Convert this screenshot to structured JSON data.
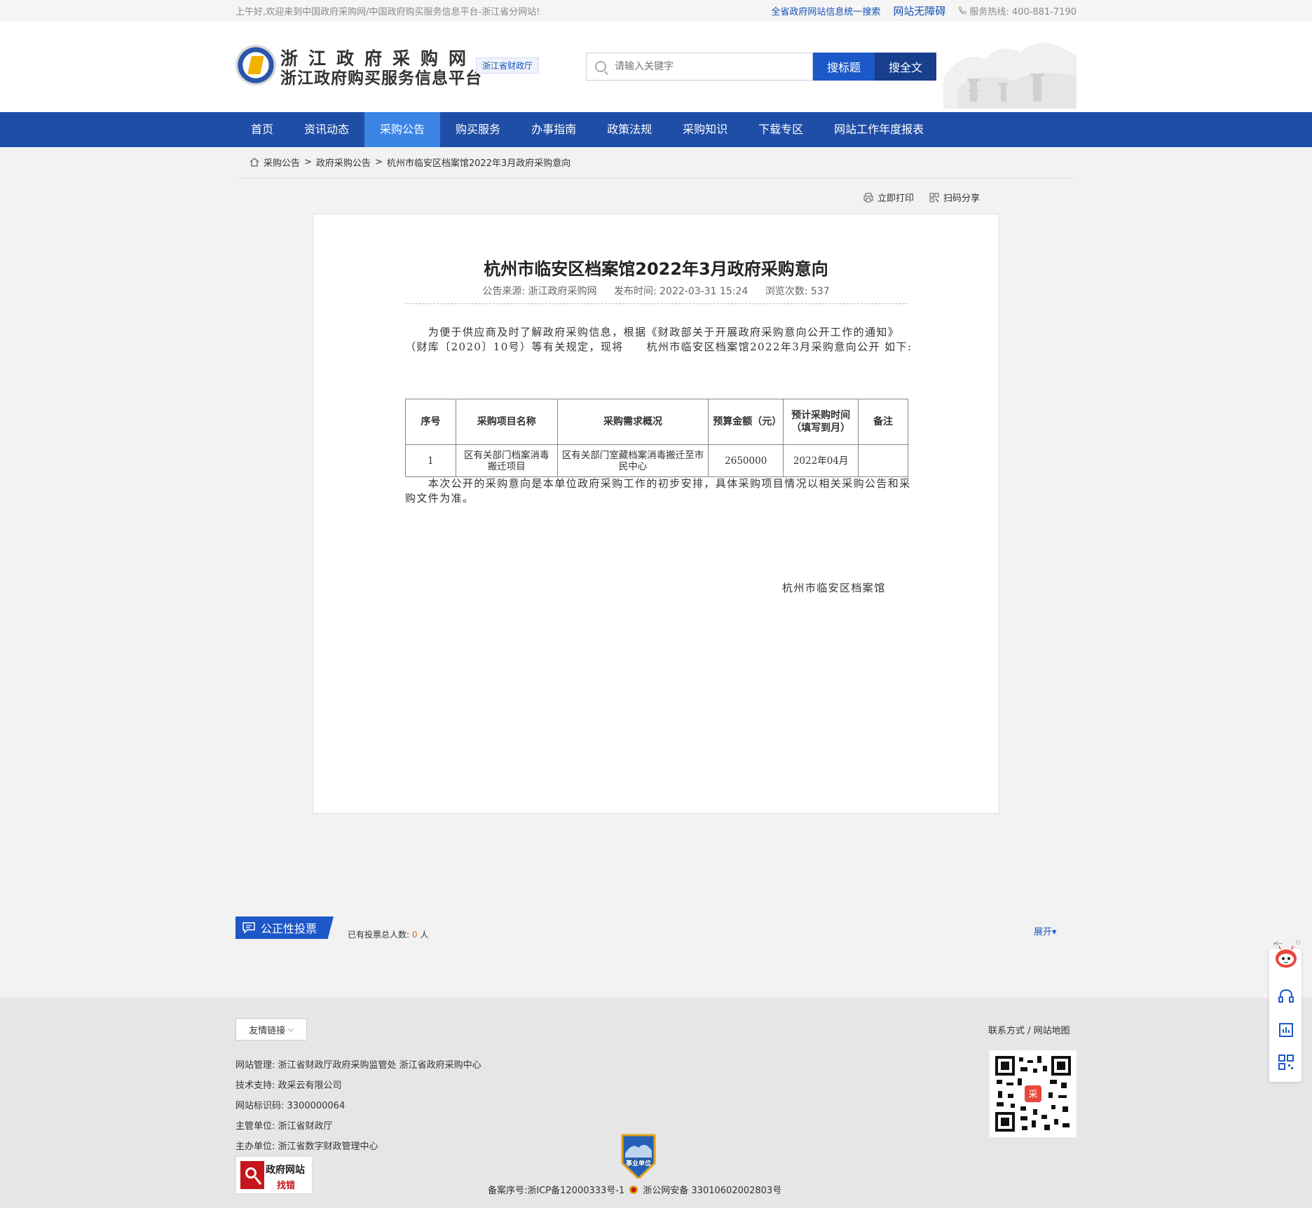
{
  "topbar": {
    "welcome": "上午好,欢迎来到中国政府采购网/中国政府购买服务信息平台-浙江省分网站!",
    "search_all": "全省政府网站信息统一搜索",
    "accessibility": "网站无障碍",
    "hotline": "服务热线: 400-881-7190"
  },
  "header": {
    "title": "浙江政府采购网",
    "subtitle": "浙江政府购买服务信息平台",
    "badge": "浙江省财政厅",
    "search_placeholder": "请输入关键字",
    "search_title_btn": "搜标题",
    "search_full_btn": "搜全文"
  },
  "nav": {
    "items": [
      "首页",
      "资讯动态",
      "采购公告",
      "购买服务",
      "办事指南",
      "政策法规",
      "采购知识",
      "下载专区",
      "网站工作年度报表"
    ],
    "active_index": 2
  },
  "breadcrumb": [
    "采购公告",
    "政府采购公告",
    "杭州市临安区档案馆2022年3月政府采购意向"
  ],
  "tools": {
    "print": "立即打印",
    "share": "扫码分享"
  },
  "article": {
    "title": "杭州市临安区档案馆2022年3月政府采购意向",
    "source": "公告来源: 浙江政府采购网",
    "published": "发布时间: 2022-03-31 15:24",
    "views": "浏览次数: 537",
    "para1": "　　为便于供应商及时了解政府采购信息，根据《财政部关于开展政府采购意向公开工作的通知》（财库〔2020〕10号）等有关规定，现将　　杭州市临安区档案馆2022年3月采购意向公开 如下:",
    "table": {
      "headers": [
        "序号",
        "采购项目名称",
        "采购需求概况",
        "预算金额（元）",
        "预计采购时间（填写到月）",
        "备注"
      ],
      "rows": [
        [
          "1",
          "区有关部门档案消毒搬迁项目",
          "区有关部门室藏档案消毒搬迁至市民中心",
          "2650000",
          "2022年04月",
          ""
        ]
      ]
    },
    "para2": "　　本次公开的采购意向是本单位政府采购工作的初步安排，具体采购项目情况以相关采购公告和采购文件为准。",
    "signature": "杭州市临安区档案馆"
  },
  "vote": {
    "label": "公正性投票",
    "count_label": "已有投票总人数:",
    "count": "0",
    "count_unit": "人",
    "expand": "展开"
  },
  "footer": {
    "links_btn": "友情链接",
    "contact": "联系方式 / 网站地图",
    "management": "网站管理: 浙江省财政厅政府采购监管处 浙江省政府采购中心",
    "tech_support": "技术支持: 政采云有限公司",
    "site_id": "网站标识码: 3300000064",
    "supervisor": "主管单位: 浙江省财政厅",
    "host": "主办单位: 浙江省数字财政管理中心",
    "error_badge_line1": "政府网站",
    "error_badge_line2": "找错",
    "shiye_label": "事业单位",
    "icp": "备案序号:浙ICP备12000333号-1",
    "police": "浙公网安备 33010602002803号"
  },
  "float": {
    "robot_hint": "Hi~"
  },
  "colors": {
    "nav_bg": "#1f4ea7",
    "nav_active": "#3b84e6",
    "primary_btn": "#1d58c8",
    "secondary_btn": "#173f8c",
    "accent_orange": "#e86c1f"
  }
}
